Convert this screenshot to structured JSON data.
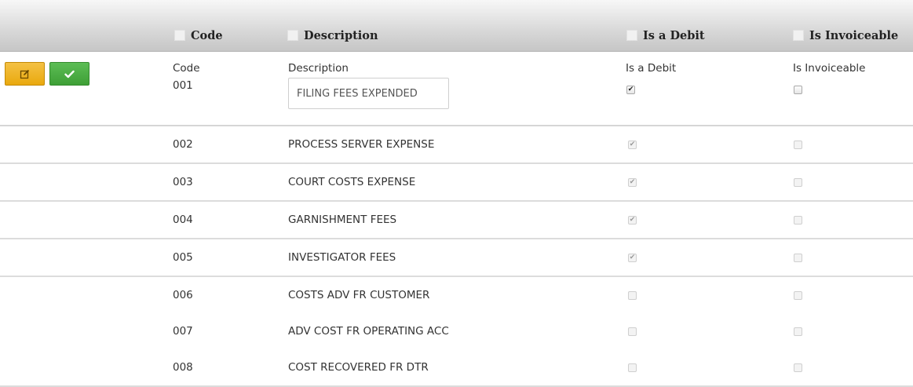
{
  "columns": {
    "code": "Code",
    "description": "Description",
    "is_debit": "Is a Debit",
    "is_invoiceable": "Is Invoiceable"
  },
  "edit_row": {
    "code_label": "Code",
    "code_value": "001",
    "description_label": "Description",
    "description_value": "FILING FEES EXPENDED",
    "is_debit_label": "Is a Debit",
    "is_debit_checked": true,
    "is_invoiceable_label": "Is Invoiceable",
    "is_invoiceable_checked": false,
    "edit_button_icon": "edit-icon",
    "save_button_icon": "checkmark-icon"
  },
  "rows": [
    {
      "code": "002",
      "description": "PROCESS SERVER EXPENSE",
      "is_debit": true,
      "is_invoiceable": false
    },
    {
      "code": "003",
      "description": "COURT COSTS EXPENSE",
      "is_debit": true,
      "is_invoiceable": false
    },
    {
      "code": "004",
      "description": "GARNISHMENT FEES",
      "is_debit": true,
      "is_invoiceable": false
    },
    {
      "code": "005",
      "description": "INVESTIGATOR FEES",
      "is_debit": true,
      "is_invoiceable": false
    },
    {
      "code": "006",
      "description": "COSTS ADV FR CUSTOMER",
      "is_debit": false,
      "is_invoiceable": false
    },
    {
      "code": "007",
      "description": "ADV COST FR OPERATING ACC",
      "is_debit": false,
      "is_invoiceable": false
    },
    {
      "code": "008",
      "description": "COST RECOVERED FR DTR",
      "is_debit": false,
      "is_invoiceable": false
    }
  ],
  "colors": {
    "edit_button": "#e9a90e",
    "save_button": "#3e9f36"
  }
}
